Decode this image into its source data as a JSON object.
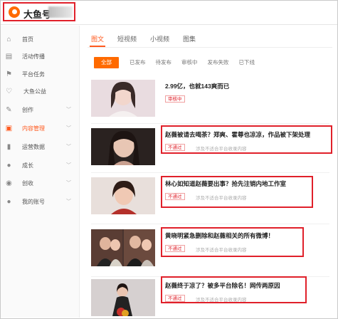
{
  "header": {
    "logo_text": "大鱼号"
  },
  "sidebar": {
    "items": [
      {
        "label": "首页",
        "icon": "home-icon",
        "chevron": false
      },
      {
        "label": "活动传播",
        "icon": "calendar-icon",
        "chevron": false
      },
      {
        "label": "平台任务",
        "icon": "flag-icon",
        "chevron": false
      },
      {
        "label": "大鱼公益",
        "icon": "heart-icon",
        "chevron": false
      },
      {
        "label": "创作",
        "icon": "pen-icon",
        "chevron": true
      },
      {
        "label": "内容管理",
        "icon": "document-icon",
        "chevron": true
      },
      {
        "label": "运营数据",
        "icon": "bar-chart-icon",
        "chevron": true
      },
      {
        "label": "成长",
        "icon": "user-icon",
        "chevron": true
      },
      {
        "label": "创收",
        "icon": "coin-icon",
        "chevron": true
      },
      {
        "label": "我的账号",
        "icon": "person-icon",
        "chevron": true
      }
    ]
  },
  "tabs": [
    "图文",
    "短视频",
    "小视频",
    "图集"
  ],
  "filters": [
    "全部",
    "已发布",
    "待发布",
    "审核中",
    "发布失败",
    "已下线"
  ],
  "articles": [
    {
      "title": "2.99亿，也就143爽而已",
      "status": "审核中",
      "reason": ""
    },
    {
      "title": "赵薇被请去喝茶？郑爽、霍尊也凉凉，作品被下架处理",
      "status": "不通过",
      "reason": "涉及不适合平台收录内容"
    },
    {
      "title": "林心如知道赵薇要出事？抢先注销内地工作室",
      "status": "不通过",
      "reason": "涉及不适合平台收录内容"
    },
    {
      "title": "黄晓明紧急删除和赵薇相关的所有微博！",
      "status": "不通过",
      "reason": "涉及不适合平台收录内容"
    },
    {
      "title": "赵薇终于凉了？被多平台除名！网传两原因",
      "status": "不通过",
      "reason": "涉及不适合平台收录内容"
    }
  ],
  "colors": {
    "accent": "#ff6a00",
    "highlight": "#e0202a"
  }
}
